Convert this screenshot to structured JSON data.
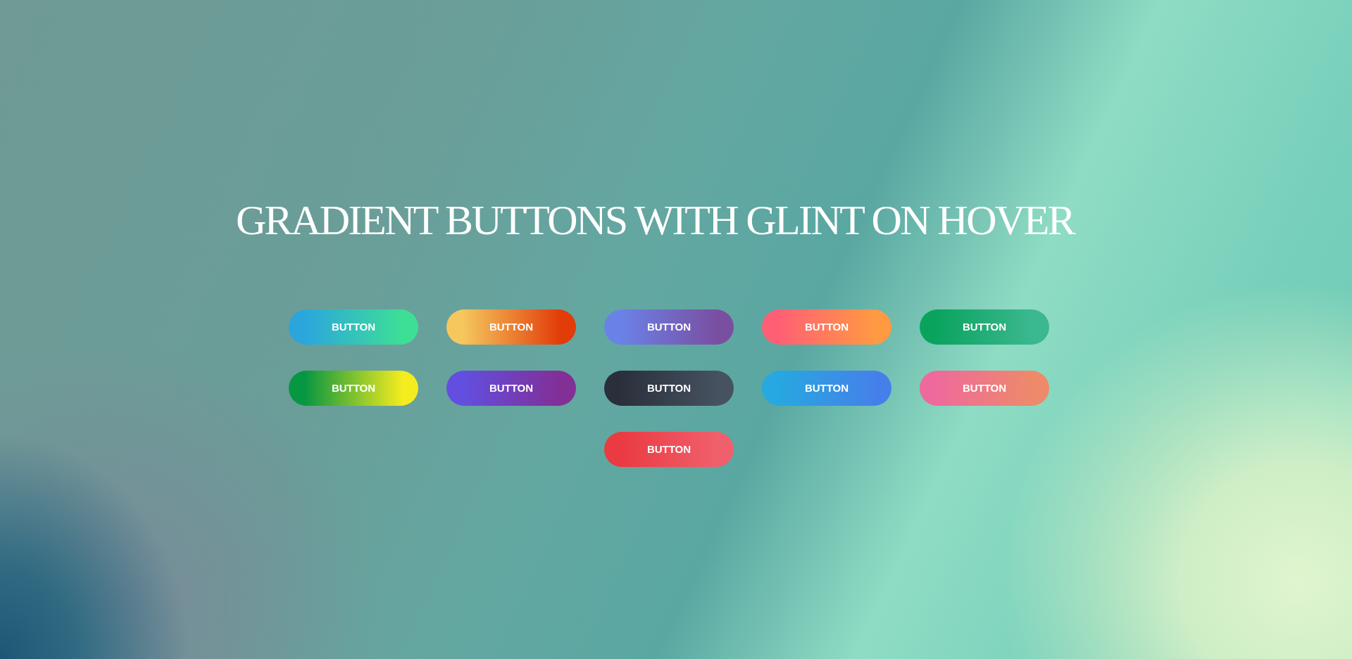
{
  "title": "GRADIENT BUTTONS WITH GLINT ON HOVER",
  "buttons": [
    {
      "label": "BUTTON",
      "gradient_stops": [
        {
          "color": "#2ba6dd"
        },
        {
          "color": "#3ddf96"
        }
      ]
    },
    {
      "label": "BUTTON",
      "gradient_stops": [
        {
          "color": "#f5c85e"
        },
        {
          "color": "#e23c08"
        }
      ]
    },
    {
      "label": "BUTTON",
      "gradient_stops": [
        {
          "color": "#6a82e8"
        },
        {
          "color": "#7a4ea0"
        }
      ]
    },
    {
      "label": "BUTTON",
      "gradient_stops": [
        {
          "color": "#ff5f75"
        },
        {
          "color": "#ff9a42"
        }
      ]
    },
    {
      "label": "BUTTON",
      "gradient_stops": [
        {
          "color": "#0aa35e"
        },
        {
          "color": "#3cb890"
        }
      ]
    },
    {
      "label": "BUTTON",
      "gradient_stops": [
        {
          "color": "#079641"
        },
        {
          "color": "#f4ec1f"
        }
      ]
    },
    {
      "label": "BUTTON",
      "gradient_stops": [
        {
          "color": "#624fe0"
        },
        {
          "color": "#822f96"
        }
      ]
    },
    {
      "label": "BUTTON",
      "gradient_stops": [
        {
          "color": "#2a2f3b"
        },
        {
          "color": "#465260"
        }
      ]
    },
    {
      "label": "BUTTON",
      "gradient_stops": [
        {
          "color": "#27a8e0"
        },
        {
          "color": "#4580ea"
        }
      ]
    },
    {
      "label": "BUTTON",
      "gradient_stops": [
        {
          "color": "#ee6a9c"
        },
        {
          "color": "#ee8a6a"
        }
      ]
    },
    {
      "label": "BUTTON",
      "gradient_stops": [
        {
          "color": "#ea3a42"
        },
        {
          "color": "#f0606c"
        }
      ]
    }
  ]
}
